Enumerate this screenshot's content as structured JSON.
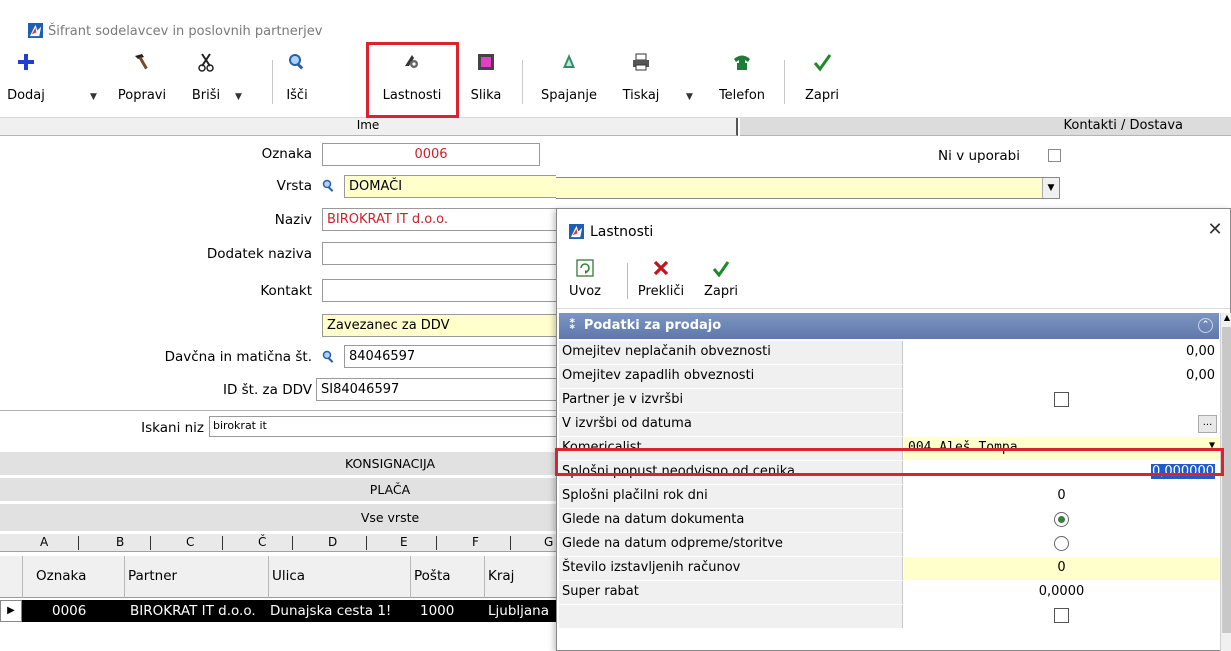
{
  "window": {
    "title": "Šifrant sodelavcev in poslovnih partnerjev"
  },
  "toolbar": {
    "dodaj": "Dodaj",
    "popravi": "Popravi",
    "brisi": "Briši",
    "isci": "Išči",
    "lastnosti": "Lastnosti",
    "slika": "Slika",
    "spajanje": "Spajanje",
    "tiskaj": "Tiskaj",
    "telefon": "Telefon",
    "zapri": "Zapri"
  },
  "tabs": {
    "ime": "Ime",
    "kontakti": "Kontakti / Dostava"
  },
  "form": {
    "oznaka_label": "Oznaka",
    "oznaka_value": "0006",
    "vrsta_label": "Vrsta",
    "vrsta_value": "DOMAČI",
    "naziv_label": "Naziv",
    "naziv_value": "BIROKRAT IT d.o.o.",
    "dodatek_label": "Dodatek naziva",
    "dodatek_value": "",
    "kontakt_label": "Kontakt",
    "kontakt_value": "",
    "ddv_status": "Zavezanec za DDV",
    "davcna_label": "Davčna in matična št.",
    "davcna_value": "84046597",
    "idddv_label": "ID št. za DDV",
    "idddv_value": "SI84046597",
    "ni_v_uporabi_label": "Ni v uporabi",
    "iskani_niz_label": "Iskani niz",
    "iskani_niz_value": "birokrat it"
  },
  "filters": {
    "konsignacija": "KONSIGNACIJA",
    "placa": "PLAČA",
    "vse_vrste": "Vse vrste"
  },
  "alpha_tabs": [
    "A",
    "B",
    "C",
    "Č",
    "D",
    "E",
    "F",
    "G"
  ],
  "grid": {
    "columns": [
      "Oznaka",
      "Partner",
      "Ulica",
      "Pošta",
      "Kraj"
    ],
    "rows": [
      {
        "oznaka": "0006",
        "partner": "BIROKRAT IT d.o.o.",
        "ulica": "Dunajska cesta 1!",
        "posta": "1000",
        "kraj": "Ljubljana"
      }
    ]
  },
  "dialog": {
    "title": "Lastnosti",
    "uvoz": "Uvoz",
    "preklici": "Prekliči",
    "zapri": "Zapri",
    "category": "Podatki za prodajo",
    "properties": [
      {
        "name": "Omejitev neplačanih obveznosti",
        "value": "0,00"
      },
      {
        "name": "Omejitev zapadlih obveznosti",
        "value": "0,00"
      },
      {
        "name": "Partner je v izvršbi",
        "value": ""
      },
      {
        "name": "V izvršbi od datuma",
        "value": ""
      },
      {
        "name": "Komericalist",
        "value": "004 Aleš Tompa"
      },
      {
        "name": "Splošni popust neodvisno od cenika",
        "value": "0,000000"
      },
      {
        "name": "Splošni plačilni rok dni",
        "value": "0"
      },
      {
        "name": "Glede na datum dokumenta",
        "value": ""
      },
      {
        "name": "Glede na datum odpreme/storitve",
        "value": ""
      },
      {
        "name": "Število izstavljenih računov",
        "value": "0"
      },
      {
        "name": "Super rabat",
        "value": "0,0000"
      }
    ]
  },
  "colors": {
    "highlight": "#d9232e",
    "field_yellow": "#ffffcc",
    "category_bar": "#6a83b5",
    "value_red": "#d0202a"
  }
}
